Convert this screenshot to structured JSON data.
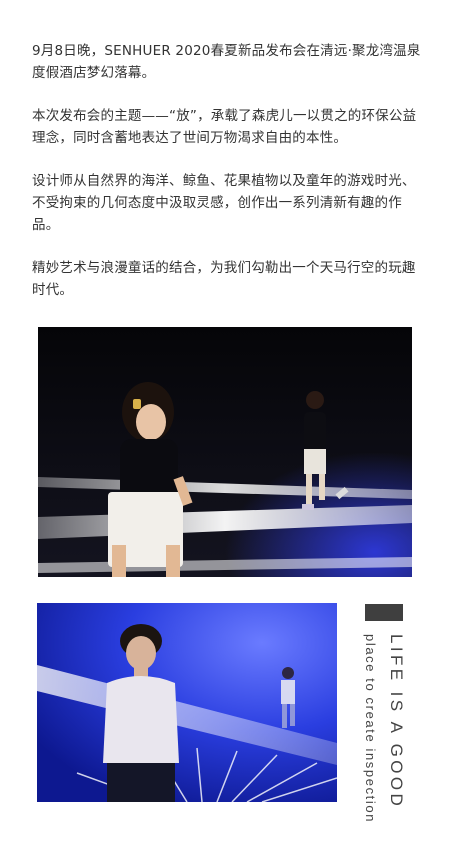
{
  "article": {
    "paragraphs": [
      "9月8日晚，SENHUER 2020春夏新品发布会在清远·聚龙湾温泉度假酒店梦幻落幕。",
      "本次发布会的主题——“放”，承载了森虎儿一以贯之的环保公益理念，同时含蓄地表达了世间万物渴求自由的本性。",
      "设计师从自然界的海洋、鲸鱼、花果植物以及童年的游戏时光、不受拘束的几何态度中汲取灵感，创作出一系列清新有趣的作品。",
      "精妙艺术与浪漫童话的结合，为我们勾勒出一个天马行空的玩趣时代。"
    ]
  },
  "images": {
    "runway_photo": "children walking on runway with white light beams",
    "portrait_photo": "boy on blue-lit runway with stage light rays"
  },
  "side_caption": {
    "line1": "LIFE IS A GOOD",
    "line2": "place to create inspection"
  },
  "colors": {
    "text": "#333333",
    "accent_bar": "#3f3f3f",
    "stage_blue": "#1a2fc8"
  }
}
